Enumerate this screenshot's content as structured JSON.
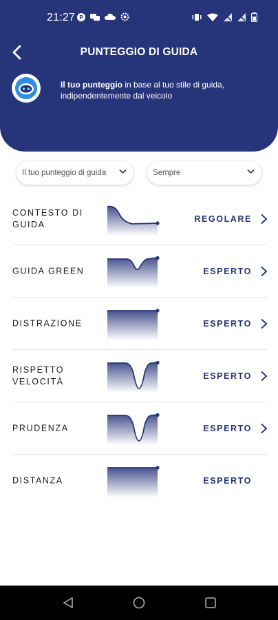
{
  "status_bar": {
    "time": "21:27"
  },
  "header": {
    "title": "PUNTEGGIO DI GUIDA",
    "intro_bold": "Il tuo punteggio",
    "intro_rest": " in base al tuo stile di guida, indipendentemente dal veicolo"
  },
  "filters": {
    "score": "Il tuo punteggio di guida",
    "period": "Sempre"
  },
  "colors": {
    "brand": "#26347a",
    "background": "#ffffff"
  },
  "rows": [
    {
      "label": "CONTESTO DI GUIDA",
      "level": "REGOLARE",
      "chevron": true,
      "trend_icon": "descending-curve"
    },
    {
      "label": "GUIDA GREEN",
      "level": "ESPERTO",
      "chevron": true,
      "trend_icon": "shallow-dip-curve"
    },
    {
      "label": "DISTRAZIONE",
      "level": "ESPERTO",
      "chevron": true,
      "trend_icon": "flat-line"
    },
    {
      "label": "RISPETTO VELOCITÀ",
      "level": "ESPERTO",
      "chevron": true,
      "trend_icon": "deep-dip-curve"
    },
    {
      "label": "PRUDENZA",
      "level": "ESPERTO",
      "chevron": true,
      "trend_icon": "deep-dip-curve"
    },
    {
      "label": "DISTANZA",
      "level": "ESPERTO",
      "chevron": false,
      "trend_icon": "flat-line"
    }
  ]
}
